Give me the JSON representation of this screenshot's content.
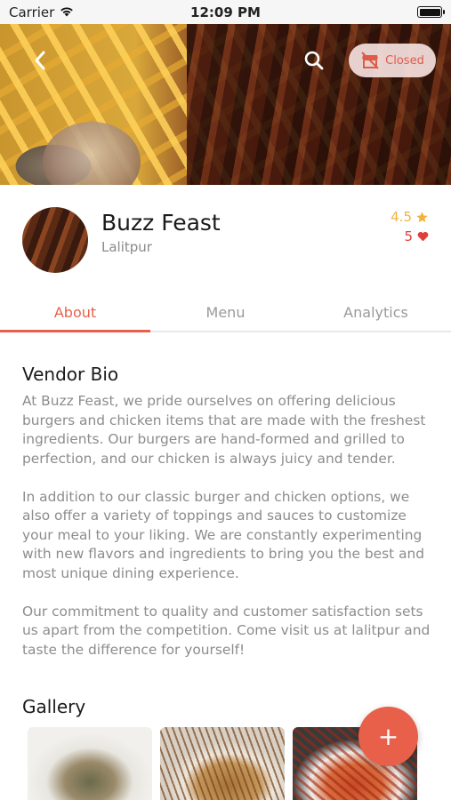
{
  "status_bar": {
    "carrier": "Carrier",
    "time": "12:09 PM"
  },
  "hero": {
    "status_badge": "Closed"
  },
  "vendor": {
    "name": "Buzz Feast",
    "location": "Lalitpur",
    "rating": "4.5",
    "likes": "5"
  },
  "tabs": [
    {
      "label": "About",
      "active": true
    },
    {
      "label": "Menu",
      "active": false
    },
    {
      "label": "Analytics",
      "active": false
    }
  ],
  "about": {
    "bio_title": "Vendor Bio",
    "bio_paragraphs": [
      "At Buzz Feast, we pride ourselves on offering delicious burgers and chicken items that are made with the freshest ingredients. Our burgers are hand-formed and grilled to perfection, and our chicken is always juicy and tender.",
      "In addition to our classic burger and chicken options, we also offer a variety of toppings and sauces to customize your meal to your liking. We are constantly experimenting with new flavors and ingredients to bring you the best and most unique dining experience.",
      "Our commitment to quality and customer satisfaction sets us apart from the competition. Come visit us at lalitpur and taste the difference for yourself!"
    ],
    "gallery_title": "Gallery"
  },
  "fab": {
    "label": "+"
  },
  "colors": {
    "accent": "#e8604a",
    "rating": "#f2b33d",
    "likes": "#e0403a"
  }
}
